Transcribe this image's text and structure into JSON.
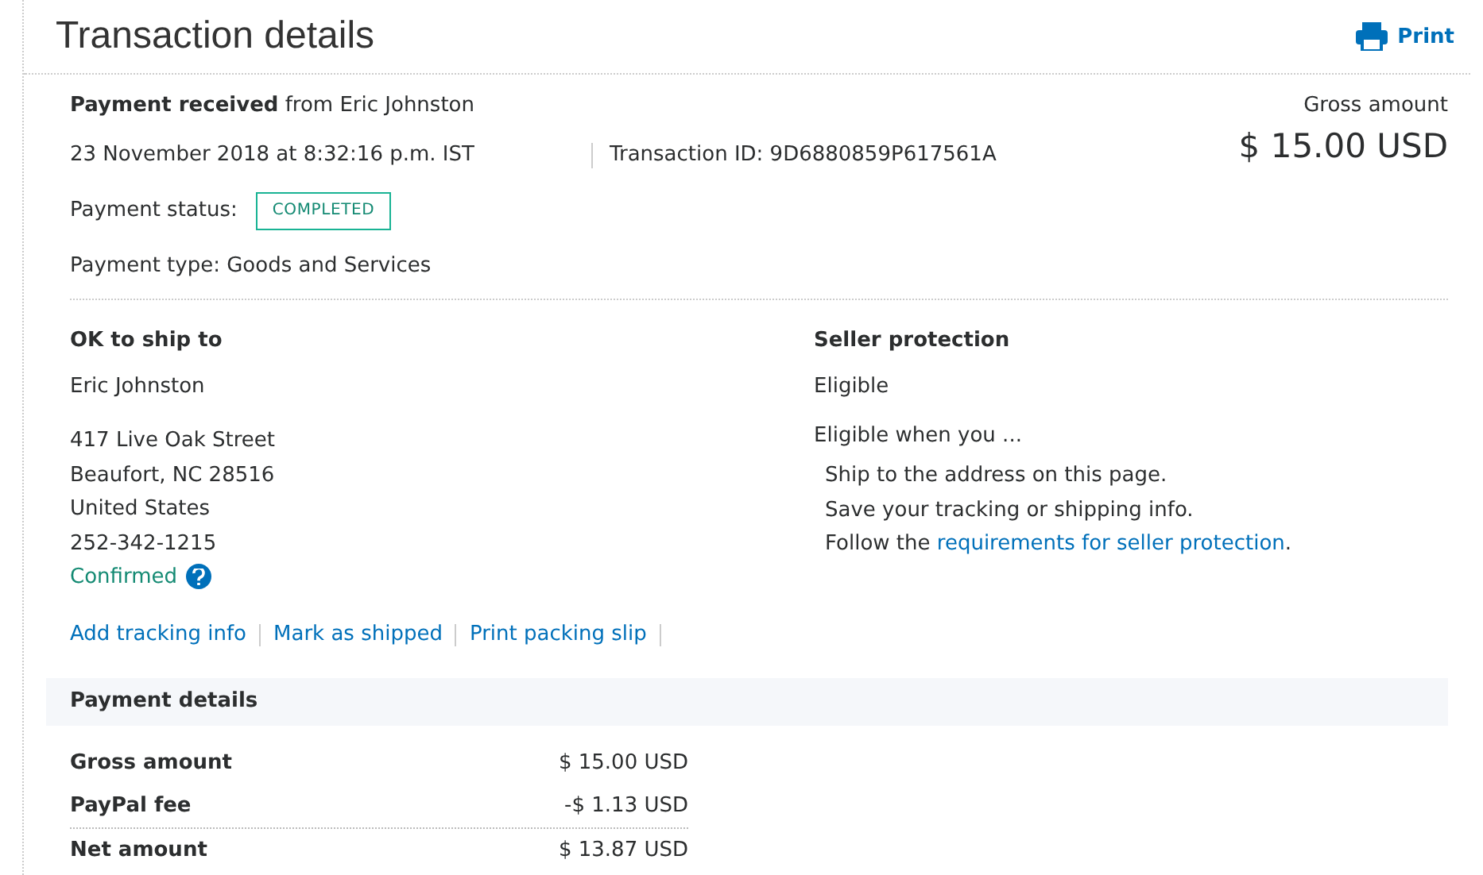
{
  "header": {
    "title": "Transaction details",
    "print_label": "Print"
  },
  "summary": {
    "headline": "**Payment received** from Eric Johnston",
    "date": "23 November 2018 at 8:32:16 p.m. IST",
    "transaction_id": "Transaction ID: 9D6880859P617561A",
    "status_label": "Payment status:",
    "status": "COMPLETED",
    "payment_type": "Payment type: Goods and Services",
    "amount_label": "Gross amount",
    "amount": "$ 15.00 USD"
  },
  "shipping": {
    "heading": "OK to ship to",
    "name": "Eric Johnston",
    "address": [
      "417 Live Oak Street",
      "Beaufort, NC 28516",
      "United States",
      "252-342-1215"
    ],
    "confirmed": "Confirmed",
    "links": [
      "Add tracking info",
      "Mark as shipped",
      "Print packing slip"
    ]
  },
  "protection": {
    "heading": "Seller protection",
    "status": "Eligible",
    "intro": "Eligible when you ...",
    "steps": [
      {
        "text": "Ship to the address on this page."
      },
      {
        "text": "Save your tracking or shipping info."
      },
      {
        "text": "Follow the ",
        "link": "requirements for seller protection",
        "after": "."
      }
    ]
  },
  "payment_details": {
    "heading": "Payment details",
    "rows": [
      {
        "label": "Gross amount",
        "value": "$ 15.00 USD"
      },
      {
        "label": "PayPal fee",
        "value": "-$ 1.13 USD"
      },
      {
        "label": "Net amount",
        "value": "$ 13.87 USD"
      }
    ]
  }
}
